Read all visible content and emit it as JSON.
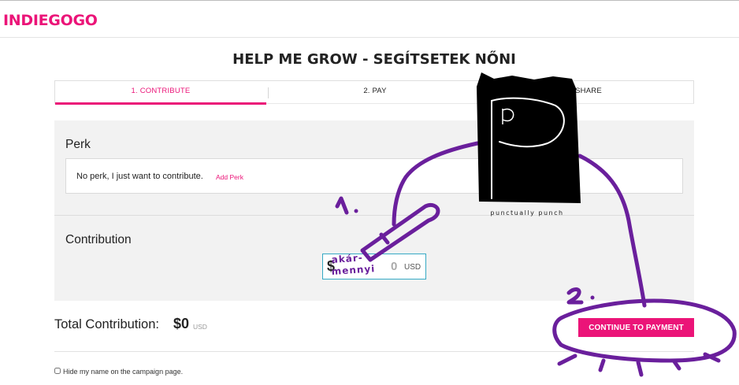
{
  "header": {
    "logo": "INDIEGOGO"
  },
  "campaign": {
    "title": "HELP ME GROW - SEGÍTSETEK NŐNI"
  },
  "steps": [
    {
      "label": "1. CONTRIBUTE",
      "active": true
    },
    {
      "label": "2. PAY",
      "active": false
    },
    {
      "label": "SHARE",
      "active": false
    }
  ],
  "perk": {
    "heading": "Perk",
    "selected_text": "No perk, I just want to contribute.",
    "add_link": "Add Perk"
  },
  "contribution": {
    "heading": "Contribution",
    "currency_sign": "$",
    "amount_value": "0",
    "currency": "USD"
  },
  "total": {
    "label": "Total Contribution:",
    "amount": "$0",
    "currency": "USD"
  },
  "actions": {
    "continue_label": "CONTINUE TO PAYMENT"
  },
  "privacy": {
    "hide_name_label": "Hide my name on the campaign page.",
    "hide_name_checked": false
  },
  "annotations": {
    "step1_marker": "1.",
    "step2_marker": "2.",
    "amount_note_line1": "akár-",
    "amount_note_line2": "mennyi",
    "mascot_letter": "P",
    "mascot_caption": "punctually punch"
  },
  "colors": {
    "brand": "#eb1478",
    "annotation": "#6a1f9c",
    "focus": "#35a9c4"
  }
}
